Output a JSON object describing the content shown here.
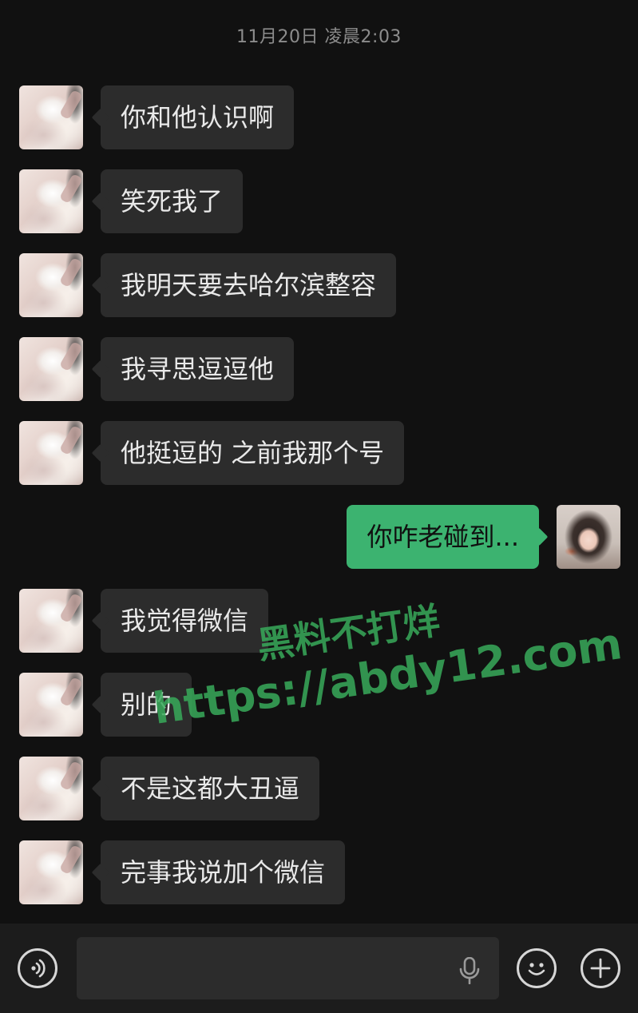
{
  "chat": {
    "timestamp": "11月20日 凌晨2:03",
    "messages": [
      {
        "sender": "them",
        "text": "你和他认识啊"
      },
      {
        "sender": "them",
        "text": "笑死我了"
      },
      {
        "sender": "them",
        "text": "我明天要去哈尔滨整容"
      },
      {
        "sender": "them",
        "text": "我寻思逗逗他"
      },
      {
        "sender": "them",
        "text": "他挺逗的 之前我那个号"
      },
      {
        "sender": "me",
        "text": "你咋老碰到..."
      },
      {
        "sender": "them",
        "text": "我觉得微信"
      },
      {
        "sender": "them",
        "text": "别的"
      },
      {
        "sender": "them",
        "text": "不是这都大丑逼"
      },
      {
        "sender": "them",
        "text": "完事我说加个微信"
      }
    ]
  },
  "watermark": {
    "line1": "黑料不打烊",
    "line2": "https://abdy12.com"
  },
  "input_bar": {
    "text_value": "",
    "voice_icon": "voice-icon",
    "mic_icon": "mic-icon",
    "emoji_icon": "emoji-icon",
    "plus_icon": "plus-icon"
  },
  "colors": {
    "background": "#111111",
    "incoming_bubble": "#2c2c2c",
    "outgoing_bubble": "#3cb370",
    "watermark": "#38aa5a"
  }
}
